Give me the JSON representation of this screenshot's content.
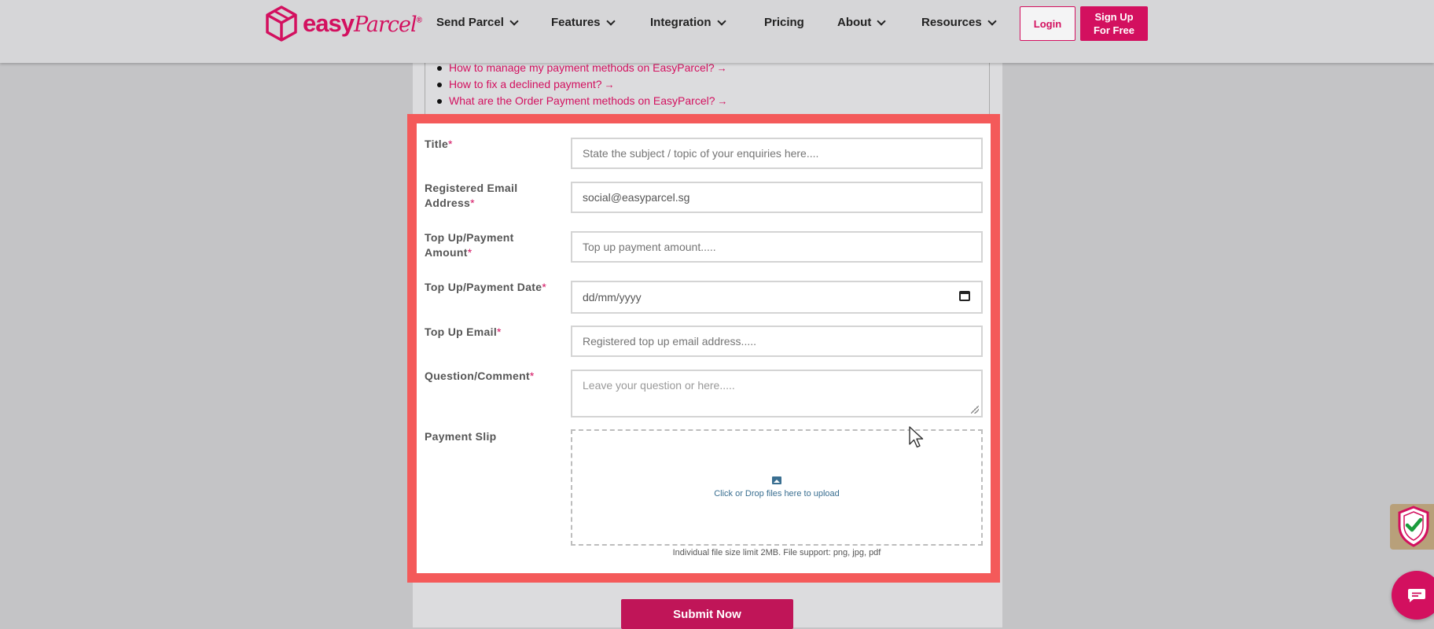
{
  "header": {
    "logo": "easy",
    "logo_script": "Parcel",
    "logo_reg": "®",
    "nav": [
      {
        "label": "Send Parcel",
        "has_dropdown": true
      },
      {
        "label": "Features",
        "has_dropdown": true
      },
      {
        "label": "Integration",
        "has_dropdown": true
      },
      {
        "label": "Pricing",
        "has_dropdown": false
      },
      {
        "label": "About",
        "has_dropdown": true
      },
      {
        "label": "Resources",
        "has_dropdown": true
      }
    ],
    "login_label": "Login",
    "signup_line1": "Sign Up",
    "signup_line2": "For Free"
  },
  "faq_links": [
    {
      "label": "How to manage my payment methods on EasyParcel?",
      "arrow": "→"
    },
    {
      "label": "How to fix a declined payment?",
      "arrow": "→"
    },
    {
      "label": "What are the Order Payment methods on EasyParcel?",
      "arrow": "→"
    }
  ],
  "form": {
    "required_mark": "*",
    "title": {
      "label": "Title",
      "placeholder": "State the subject / topic of your enquiries here...."
    },
    "email": {
      "label_line1": "Registered Email",
      "label_line2": "Address",
      "value": "social@easyparcel.sg"
    },
    "amount": {
      "label_line1": "Top Up/Payment",
      "label_line2": "Amount",
      "placeholder": "Top up payment amount....."
    },
    "date": {
      "label": "Top Up/Payment Date",
      "placeholder": "dd/mm/yyyy"
    },
    "topup_email": {
      "label": "Top Up Email",
      "placeholder": "Registered top up email address....."
    },
    "comment": {
      "label": "Question/Comment",
      "placeholder": "Leave your question or here....."
    },
    "slip": {
      "label": "Payment Slip",
      "upload_text": "Click or Drop files here to upload",
      "note": "Individual file size limit 2MB. File support: png, jpg, pdf"
    },
    "submit_label": "Submit Now"
  },
  "colors": {
    "brand": "#d3105f",
    "highlight": "#f45a5a",
    "submit": "#c01558",
    "upload_text": "#3a6f91"
  },
  "icons": [
    "logo-box-icon",
    "chevron-down-icon",
    "arrow-right-icon",
    "calendar-icon",
    "image-icon",
    "cursor-icon",
    "shield-check-icon",
    "chat-icon",
    "resize-grip-icon"
  ]
}
